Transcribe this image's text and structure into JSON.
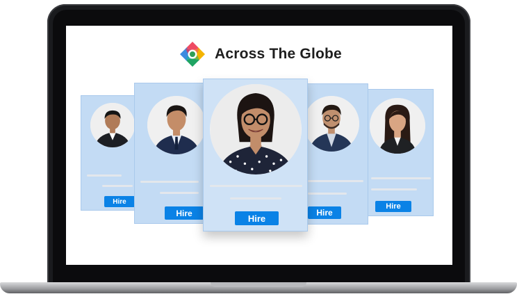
{
  "brand": {
    "name": "Across The Globe",
    "logo_icon": "multicolor-compass-logo"
  },
  "cards": [
    {
      "id": "card-1",
      "button_label": "Hire",
      "avatar_icon": "person-avatar-man"
    },
    {
      "id": "card-2",
      "button_label": "Hire",
      "avatar_icon": "person-avatar-man"
    },
    {
      "id": "card-3",
      "button_label": "Hire",
      "avatar_icon": "person-avatar-woman-glasses"
    },
    {
      "id": "card-4",
      "button_label": "Hire",
      "avatar_icon": "person-avatar-man-glasses"
    },
    {
      "id": "card-5",
      "button_label": "Hire",
      "avatar_icon": "person-avatar-woman"
    }
  ],
  "colors": {
    "card": "#c3dbf4",
    "button": "#0a82e6",
    "laptop": "#1a1b1e"
  }
}
